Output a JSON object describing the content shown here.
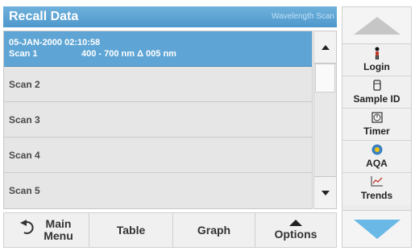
{
  "header": {
    "title": "Recall Data",
    "mode": "Wavelength Scan"
  },
  "scans": [
    {
      "date": "05-JAN-2000 02:10:58",
      "name": "Scan 1",
      "range": "400 - 700 nm Δ 005 nm",
      "selected": true
    },
    {
      "name": "Scan 2"
    },
    {
      "name": "Scan 3"
    },
    {
      "name": "Scan 4"
    },
    {
      "name": "Scan 5"
    }
  ],
  "scrollbar": {
    "up_icon": "triangle-up-icon",
    "down_icon": "triangle-down-icon"
  },
  "side_panel": {
    "login": {
      "label": "Login",
      "icon": "person-icon"
    },
    "sample_id": {
      "label": "Sample ID",
      "icon": "sample-icon"
    },
    "timer": {
      "label": "Timer",
      "icon": "timer-icon"
    },
    "aqa": {
      "label": "AQA",
      "icon": "aqa-icon"
    },
    "trends": {
      "label": "Trends",
      "icon": "trend-chart-icon"
    }
  },
  "bottom": {
    "main_menu_line1": "Main",
    "main_menu_line2": "Menu",
    "table": "Table",
    "graph": "Graph",
    "options": "Options"
  },
  "colors": {
    "accent": "#5ea5d5",
    "title_bar": "#4e98cc",
    "arrow_blue": "#6ab8e6"
  }
}
